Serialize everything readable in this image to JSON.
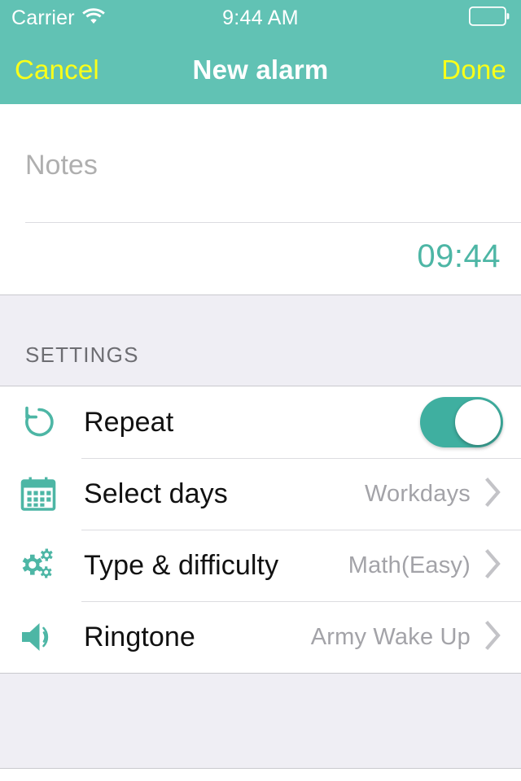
{
  "status_bar": {
    "carrier": "Carrier",
    "wifi_icon": "wifi-icon",
    "time": "9:44 AM",
    "battery_icon": "battery-icon"
  },
  "nav_bar": {
    "cancel_label": "Cancel",
    "title": "New alarm",
    "done_label": "Done"
  },
  "notes": {
    "placeholder": "Notes",
    "value": ""
  },
  "alarm": {
    "time": "09:44"
  },
  "settings": {
    "section_title": "SETTINGS",
    "rows": [
      {
        "icon": "repeat-icon",
        "label": "Repeat",
        "control": "toggle",
        "toggle_on": true
      },
      {
        "icon": "calendar-icon",
        "label": "Select days",
        "value": "Workdays",
        "control": "chevron"
      },
      {
        "icon": "gears-icon",
        "label": "Type & difficulty",
        "value": "Math(Easy)",
        "control": "chevron"
      },
      {
        "icon": "speaker-icon",
        "label": "Ringtone",
        "value": "Army Wake Up",
        "control": "chevron"
      }
    ]
  },
  "colors": {
    "accent_teal": "#61C2B4",
    "toggle_on": "#3FAFA0",
    "action_yellow": "#FBFF19",
    "time_teal": "#4DB6A5",
    "section_bg": "#EFEEF4",
    "muted_text": "#A3A3A8"
  }
}
